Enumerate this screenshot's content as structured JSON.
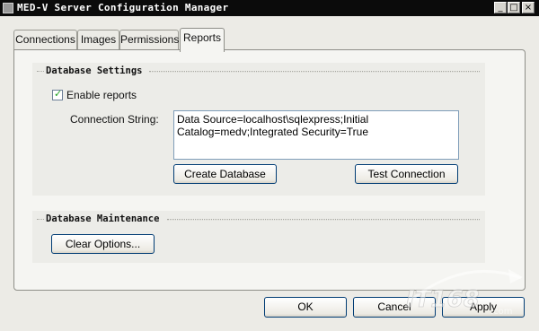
{
  "window": {
    "title": "MED-V Server Configuration Manager",
    "controls": {
      "minimize": "_",
      "maximize": "□",
      "close": "×"
    }
  },
  "tabs": [
    {
      "label": "Connections",
      "selected": false
    },
    {
      "label": "Images",
      "selected": false
    },
    {
      "label": "Permissions",
      "selected": false
    },
    {
      "label": "Reports",
      "selected": true
    }
  ],
  "database_settings": {
    "title": "Database Settings",
    "enable_reports": {
      "label": "Enable reports",
      "checked": true
    },
    "connection_string": {
      "label": "Connection String:",
      "value": "Data Source=localhost\\sqlexpress;Initial Catalog=medv;Integrated Security=True"
    },
    "create_button": "Create Database",
    "test_button": "Test Connection"
  },
  "database_maintenance": {
    "title": "Database Maintenance",
    "clear_button": "Clear Options..."
  },
  "dialog_buttons": {
    "ok": "OK",
    "cancel": "Cancel",
    "apply": "Apply"
  },
  "watermark": {
    "brand": "IT168",
    "suffix": ".com"
  },
  "colors": {
    "titlebar": "#0b0b0b",
    "button_border": "#003c74",
    "dialog_bg": "#ecebe6",
    "check_green": "#21a121"
  }
}
